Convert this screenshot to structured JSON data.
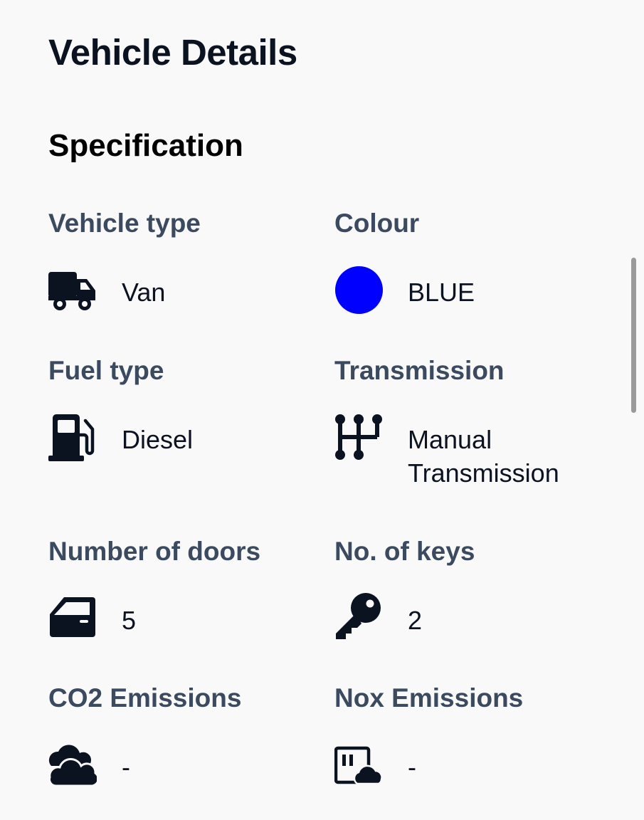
{
  "page": {
    "title": "Vehicle Details"
  },
  "specification": {
    "section_title": "Specification",
    "items": [
      {
        "label": "Vehicle type",
        "value": "Van",
        "icon": "van-icon"
      },
      {
        "label": "Colour",
        "value": "BLUE",
        "icon": "color-swatch",
        "swatch_color": "#0000ff"
      },
      {
        "label": "Fuel type",
        "value": "Diesel",
        "icon": "fuel-pump-icon"
      },
      {
        "label": "Transmission",
        "value": "Manual Transmission",
        "icon": "gear-shift-icon"
      },
      {
        "label": "Number of doors",
        "value": "5",
        "icon": "car-door-icon"
      },
      {
        "label": "No. of keys",
        "value": "2",
        "icon": "key-icon"
      },
      {
        "label": "CO2 Emissions",
        "value": "-",
        "icon": "clouds-icon"
      },
      {
        "label": "Nox Emissions",
        "value": "-",
        "icon": "factory-cloud-icon"
      }
    ]
  },
  "colors": {
    "label": "#3b4a5e",
    "text": "#0b1220",
    "background": "#f9f9f9"
  }
}
